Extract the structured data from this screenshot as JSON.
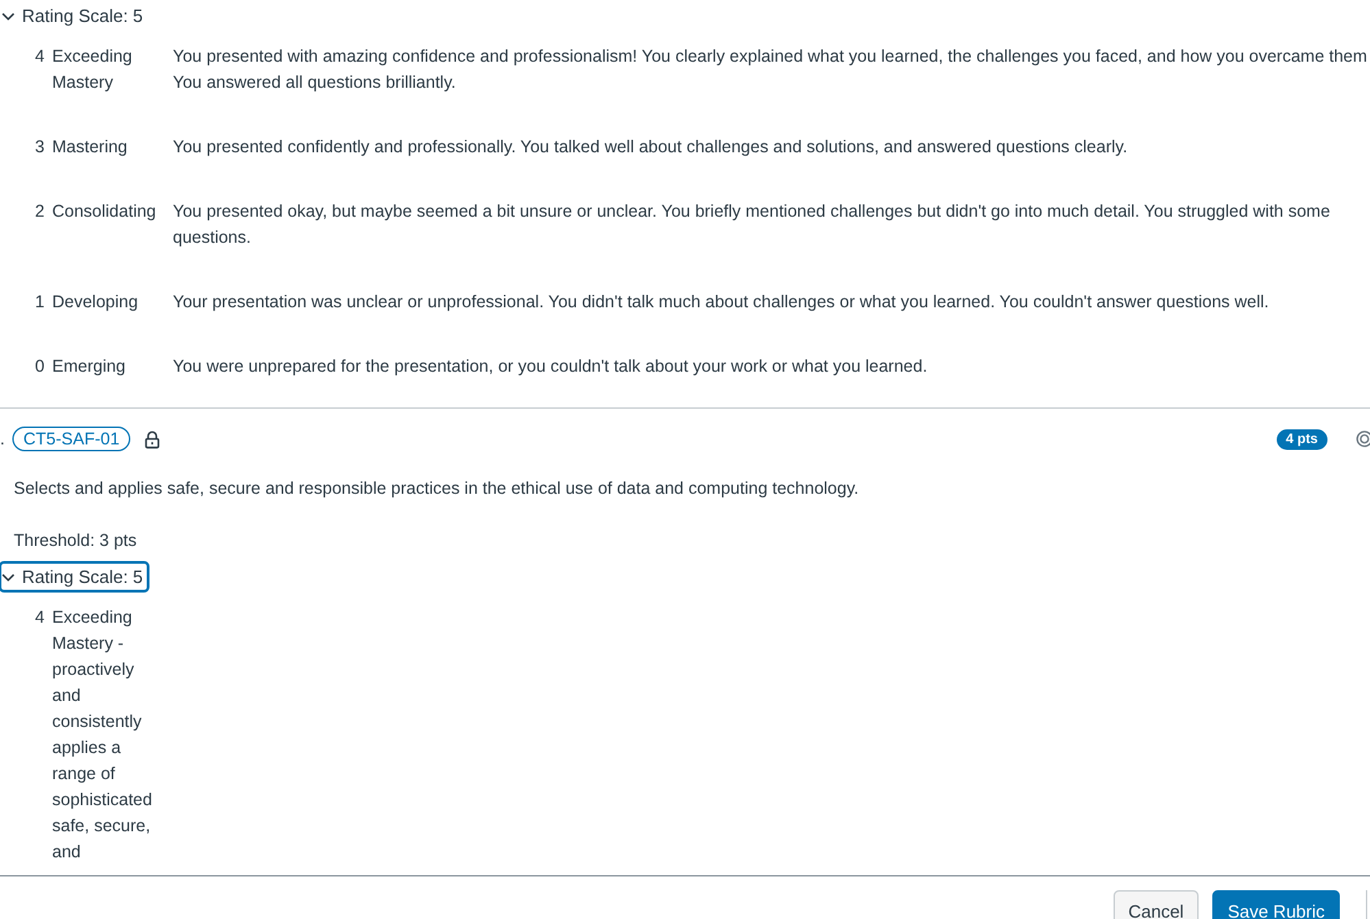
{
  "rating_scale": {
    "label": "Rating Scale: 5",
    "expanded": true,
    "focused": false,
    "ratings": [
      {
        "points": "4",
        "name": "Exceeding\nMastery",
        "description": "You presented with amazing confidence and professionalism! You clearly explained what you learned, the challenges you faced, and how you overcame them\nYou answered all questions brilliantly."
      },
      {
        "points": "3",
        "name": "Mastering",
        "description": "You presented confidently and professionally. You talked well about challenges and solutions, and answered questions clearly."
      },
      {
        "points": "2",
        "name": "Consolidating",
        "description": "You presented okay, but maybe seemed a bit unsure or unclear. You briefly mentioned challenges but didn't go into much detail. You struggled with some\nquestions."
      },
      {
        "points": "1",
        "name": "Developing",
        "description": "Your presentation was unclear or unprofessional. You didn't talk much about challenges or what you learned. You couldn't answer questions well."
      },
      {
        "points": "0",
        "name": "Emerging",
        "description": "You were unprepared for the presentation, or you couldn't talk about your work or what you learned."
      }
    ]
  },
  "criterion": {
    "marker": ".",
    "outcome": "CT5-SAF-01",
    "locked": true,
    "points": "4 pts",
    "description": "Selects and applies safe, secure and responsible practices in the ethical use of data and computing technology.",
    "threshold": "Threshold: 3 pts",
    "rating_scale": {
      "label": "Rating Scale: 5",
      "expanded": true,
      "focused": true,
      "ratings": [
        {
          "points": "4",
          "name": "Exceeding\nMastery -\nproactively\nand\nconsistently\napplies a\nrange of\nsophisticated\nsafe, secure,\nand"
        }
      ]
    }
  },
  "footer": {
    "buttons": [
      {
        "label": "Cancel",
        "kind": "secondary"
      },
      {
        "label": "Save Rubric",
        "kind": "primary"
      }
    ]
  }
}
